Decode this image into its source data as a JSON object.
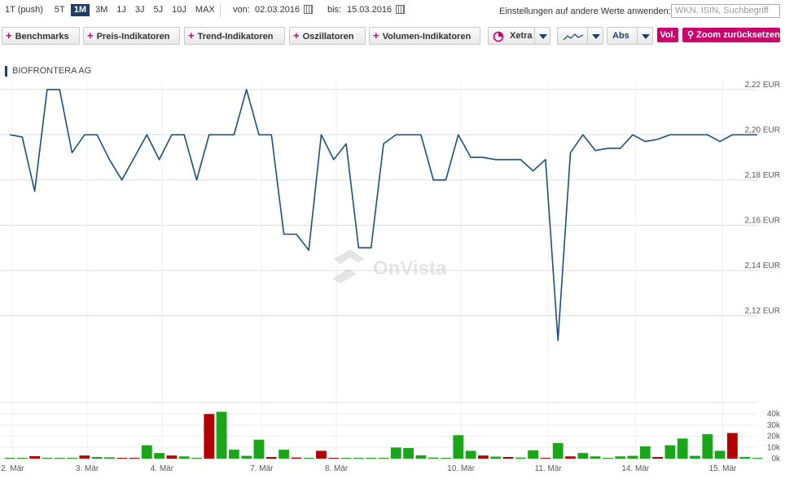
{
  "header": {
    "ranges": [
      {
        "label": "1T (push)",
        "active": false
      },
      {
        "label": "5T",
        "active": false
      },
      {
        "label": "1M",
        "active": true
      },
      {
        "label": "3M",
        "active": false
      },
      {
        "label": "1J",
        "active": false
      },
      {
        "label": "3J",
        "active": false
      },
      {
        "label": "5J",
        "active": false
      },
      {
        "label": "10J",
        "active": false
      },
      {
        "label": "MAX",
        "active": false
      }
    ],
    "from_label": "von:",
    "from_date": "02.03.2016",
    "to_label": "bis:",
    "to_date": "15.03.2016",
    "apply_label": "Einstellungen auf andere Werte anwenden:",
    "search_placeholder": "WKN, ISIN, Suchbegriff"
  },
  "toolbar": {
    "benchmarks": "Benchmarks",
    "price_indicators": "Preis-Indikatoren",
    "trend_indicators": "Trend-Indikatoren",
    "oscillators": "Oszillatoren",
    "volume_indicators": "Volumen-Indikatoren",
    "exchange": "Xetra",
    "scale": "Abs",
    "vol": "Vol.",
    "zoom_reset": "Zoom zurücksetzen"
  },
  "colors": {
    "line": "#1f4e7a",
    "up": "#1aa51a",
    "down": "#b30000",
    "accent": "#c9006b",
    "grid": "#dddddd"
  },
  "watermark": "OnVista",
  "chart_data": {
    "type": "line",
    "title": "BIOFRONTERA AG",
    "currency": "EUR",
    "ylim": [
      2.1,
      2.225
    ],
    "y_ticks": [
      "2,22 EUR",
      "2,20 EUR",
      "2,18 EUR",
      "2,16 EUR",
      "2,14 EUR",
      "2,12 EUR"
    ],
    "y_tick_values": [
      2.22,
      2.2,
      2.18,
      2.16,
      2.14,
      2.12
    ],
    "x_tick_labels": [
      "2. Mär",
      "3. Mär",
      "4. Mär",
      "7. Mär",
      "8. Mär",
      "10. Mär",
      "11. Mär",
      "14. Mär",
      "15. Mär"
    ],
    "x_tick_index": [
      1,
      7,
      13,
      21,
      27,
      37,
      44,
      51,
      58
    ],
    "series": [
      {
        "values": [
          2.2,
          2.199,
          2.175,
          2.22,
          2.22,
          2.192,
          2.2,
          2.2,
          2.189,
          2.18,
          2.19,
          2.2,
          2.189,
          2.2,
          2.2,
          2.18,
          2.2,
          2.2,
          2.2,
          2.22,
          2.2,
          2.2,
          2.156,
          2.156,
          2.149,
          2.2,
          2.189,
          2.196,
          2.15,
          2.15,
          2.196,
          2.2,
          2.2,
          2.2,
          2.18,
          2.18,
          2.2,
          2.19,
          2.19,
          2.189,
          2.189,
          2.189,
          2.184,
          2.189,
          2.109,
          2.192,
          2.2,
          2.193,
          2.194,
          2.194,
          2.2,
          2.197,
          2.198,
          2.2,
          2.2,
          2.2,
          2.2,
          2.197,
          2.2,
          2.2,
          2.2
        ]
      }
    ],
    "volume": {
      "ylim": [
        0,
        45000
      ],
      "y_ticks": [
        "40k",
        "30k",
        "20k",
        "10k",
        "0k"
      ],
      "y_tick_values": [
        40000,
        30000,
        20000,
        10000,
        0
      ],
      "values": [
        200,
        600,
        2200,
        0,
        0,
        0,
        2800,
        1500,
        1200,
        500,
        400,
        12000,
        5000,
        2800,
        2000,
        0,
        40000,
        42000,
        8000,
        2500,
        17000,
        1500,
        8000,
        1000,
        0,
        7000,
        500,
        400,
        0,
        0,
        0,
        10000,
        9500,
        3000,
        1000,
        500,
        21000,
        7000,
        2800,
        1800,
        1500,
        1000,
        7500,
        600,
        14000,
        2000,
        5000,
        2000,
        0,
        2000,
        2500,
        11000,
        1500,
        12000,
        18000,
        2500,
        22000,
        7000,
        23000,
        1500,
        0
      ],
      "down": [
        false,
        false,
        true,
        false,
        false,
        false,
        true,
        false,
        false,
        true,
        true,
        false,
        false,
        true,
        false,
        false,
        true,
        false,
        false,
        false,
        false,
        true,
        false,
        true,
        false,
        true,
        true,
        false,
        false,
        false,
        false,
        false,
        false,
        false,
        false,
        false,
        false,
        false,
        true,
        false,
        true,
        false,
        false,
        true,
        false,
        true,
        false,
        false,
        false,
        false,
        false,
        false,
        true,
        false,
        false,
        false,
        false,
        false,
        true,
        false,
        false
      ]
    }
  }
}
